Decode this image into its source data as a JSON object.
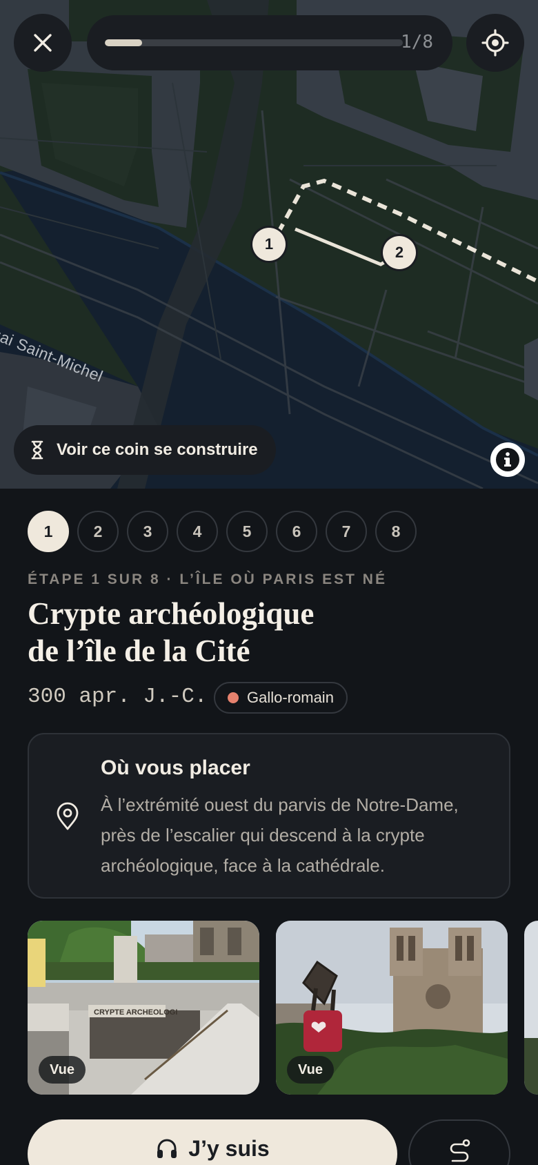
{
  "header": {
    "progress_text": "1/8",
    "progress_fraction": 0.125
  },
  "map": {
    "street_label": "uai Saint-Michel",
    "markers": [
      "1",
      "2"
    ],
    "build_button_label": "Voir ce coin se construire"
  },
  "steps": [
    "1",
    "2",
    "3",
    "4",
    "5",
    "6",
    "7",
    "8"
  ],
  "step_active": "1",
  "detail": {
    "eyebrow": "ÉTAPE 1 SUR 8 · L’ÎLE OÙ PARIS EST NÉ",
    "title_line1": "Crypte archéologique",
    "title_line2": "de l’île de la Cité",
    "date": "300 apr. J.-C.",
    "era": "Gallo-romain",
    "era_color": "#e6826e"
  },
  "place": {
    "heading": "Où vous placer",
    "description": "À l’extrémité ouest du parvis de Notre-Dame, près de l’escalier qui descend à la crypte archéologique, face à la cathédrale."
  },
  "photos": [
    {
      "badge": "Vue",
      "scene": "crypt-entrance"
    },
    {
      "badge": "Vue",
      "scene": "notre-dame-padlock"
    }
  ],
  "actions": {
    "primary_label": "J’y suis"
  },
  "icons": {
    "close": "close-icon",
    "locate": "crosshair-icon",
    "hourglass": "hourglass-icon",
    "info": "info-icon",
    "pin": "map-pin-icon",
    "headphones": "headphones-icon",
    "route": "route-icon"
  },
  "colors": {
    "accent_cream": "#efe8dc",
    "background": "#121519",
    "surface": "#1a1d22"
  }
}
